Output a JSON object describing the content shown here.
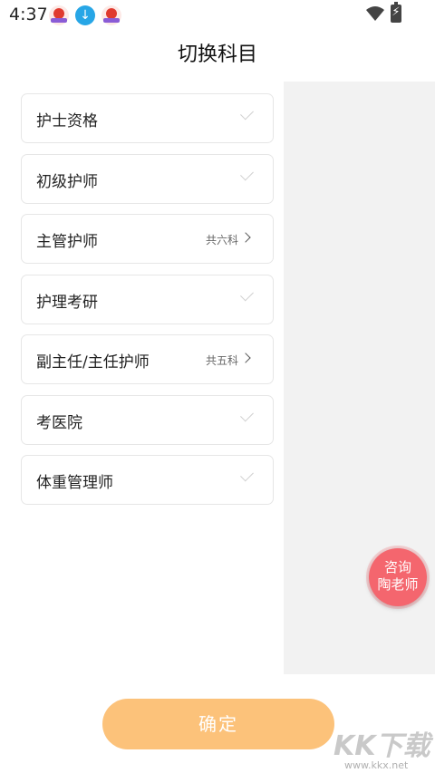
{
  "status_bar": {
    "time": "4:37",
    "icons": [
      "app-icon",
      "download-icon",
      "app-icon",
      "wifi-icon",
      "battery-charging-icon"
    ]
  },
  "header": {
    "title": "切换科目"
  },
  "subjects": [
    {
      "label": "护士资格",
      "count": "",
      "indicator": "check"
    },
    {
      "label": "初级护师",
      "count": "",
      "indicator": "check"
    },
    {
      "label": "主管护师",
      "count": "共六科",
      "indicator": "chevron"
    },
    {
      "label": "护理考研",
      "count": "",
      "indicator": "check"
    },
    {
      "label": "副主任/主任护师",
      "count": "共五科",
      "indicator": "chevron"
    },
    {
      "label": "考医院",
      "count": "",
      "indicator": "check"
    },
    {
      "label": "体重管理师",
      "count": "",
      "indicator": "check"
    }
  ],
  "consult_button": {
    "line1": "咨询",
    "line2": "陶老师"
  },
  "confirm_button": {
    "label": "确定"
  },
  "watermark": {
    "text": "KK下载",
    "url": "www.kkx.net"
  },
  "colors": {
    "accent": "#fcc27a",
    "consult": "#f4666e",
    "panel": "#f2f2f2"
  }
}
